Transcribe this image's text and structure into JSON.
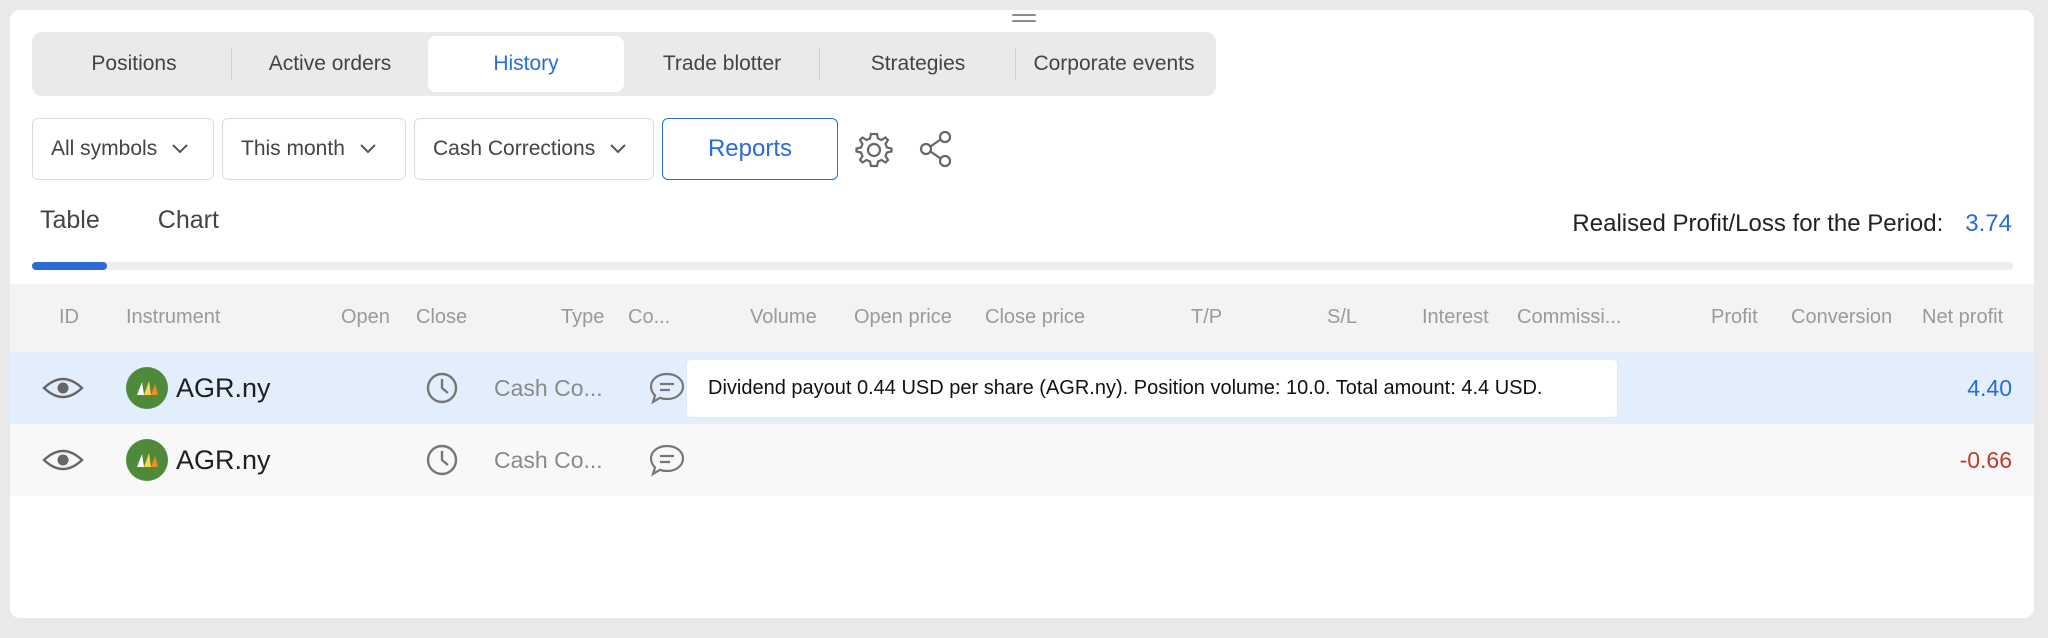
{
  "tabs": [
    "Positions",
    "Active orders",
    "History",
    "Trade blotter",
    "Strategies",
    "Corporate events"
  ],
  "active_tab": "History",
  "filters": {
    "symbols": "All symbols",
    "period": "This month",
    "type": "Cash Corrections",
    "reports_label": "Reports"
  },
  "view_tabs": [
    "Table",
    "Chart"
  ],
  "summary": {
    "label": "Realised Profit/Loss for the Period:",
    "value": "3.74"
  },
  "columns": [
    "ID",
    "Instrument",
    "Open",
    "Close",
    "Type",
    "Co...",
    "Volume",
    "Open price",
    "Close price",
    "T/P",
    "S/L",
    "Interest",
    "Commissi...",
    "Profit",
    "Conversion",
    "Net profit"
  ],
  "rows": [
    {
      "instrument": "AGR.ny",
      "type": "Cash Co...",
      "net_profit": "4.40",
      "net_color": "#2a6bd6"
    },
    {
      "instrument": "AGR.ny",
      "type": "Cash Co...",
      "net_profit": "-0.66",
      "net_color": "#c0392b"
    }
  ],
  "tooltip": "Dividend payout 0.44 USD per share (AGR.ny). Position volume: 10.0. Total amount: 4.4 USD.",
  "colors": {
    "accent": "#2a6bd6",
    "negative": "#c0392b",
    "selected_row": "#e3eefd"
  },
  "icons": [
    "eye-icon",
    "clock-icon",
    "comment-icon",
    "chevron-down-icon",
    "gear-icon",
    "share-icon",
    "drag-handle-icon"
  ]
}
